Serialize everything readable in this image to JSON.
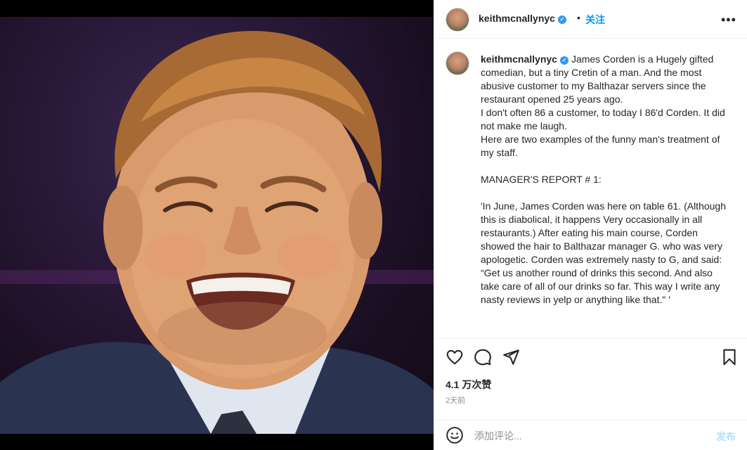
{
  "post": {
    "username": "keithmcnallynyc",
    "dot": "•",
    "follow_label": "关注",
    "more_icon": "more-horizontal-icon",
    "caption_lines": [
      "James Corden is a Hugely gifted comedian, but a tiny Cretin of a man. And the most abusive customer to my Balthazar servers since the restaurant opened 25 years ago.",
      "I don't often 86 a customer, to today I 86'd Corden. It did not make me laugh.",
      "Here are two examples of the funny man's treatment of my staff.",
      "",
      "MANAGER'S REPORT # 1:",
      "",
      "'In June, James Corden was here on table 61. (Although this is diabolical, it happens Very occasionally in all restaurants.) After eating his main course, Corden showed the hair to Balthazar manager G. who was very apologetic. Corden was extremely nasty to G, and said:",
      "“Get us another round of drinks this second. And also take care of all of our drinks so far. This way I write any nasty reviews in yelp or anything like that.\" '"
    ],
    "likes": "4.1 万次赞",
    "time_ago": "2天前",
    "comment_placeholder": "添加评论...",
    "post_label": "发布"
  },
  "colors": {
    "accent": "#0095f6",
    "verified": "#3897f0",
    "post_disabled": "#b2dffc",
    "muted": "#8e8e8e"
  }
}
